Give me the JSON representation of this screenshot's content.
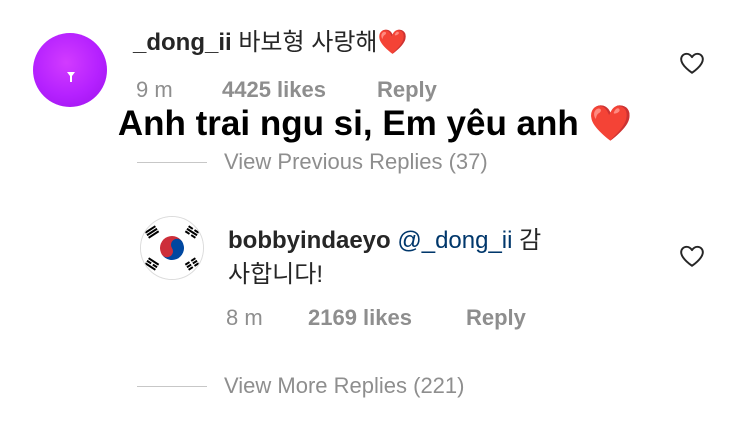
{
  "comment": {
    "username": "_dong_ii",
    "text": " 바보형 사랑해",
    "emoji": "❤️",
    "time": "9 m",
    "likes": "4425 likes",
    "reply": "Reply"
  },
  "overlay_caption": {
    "text": "Anh trai ngu si, Em yêu anh",
    "emoji": "❤️"
  },
  "view_previous": "View Previous Replies (37)",
  "reply_comment": {
    "username": "bobbyindaeyo",
    "mention": " @_dong_ii",
    "text_line1_tail": " 감",
    "text_line2": "사합니다!",
    "time": "8 m",
    "likes": "2169 likes",
    "reply": "Reply"
  },
  "view_more": "View More Replies (221)",
  "colors": {
    "avatar_purple": "#b521ff",
    "heart_red": "#e8112d",
    "meta_gray": "#8e8e8e",
    "mention_blue": "#00376b"
  },
  "icons": [
    "heart-outline-icon",
    "heart-emoji-icon",
    "korea-flag-icon",
    "avatar-mark-icon"
  ]
}
